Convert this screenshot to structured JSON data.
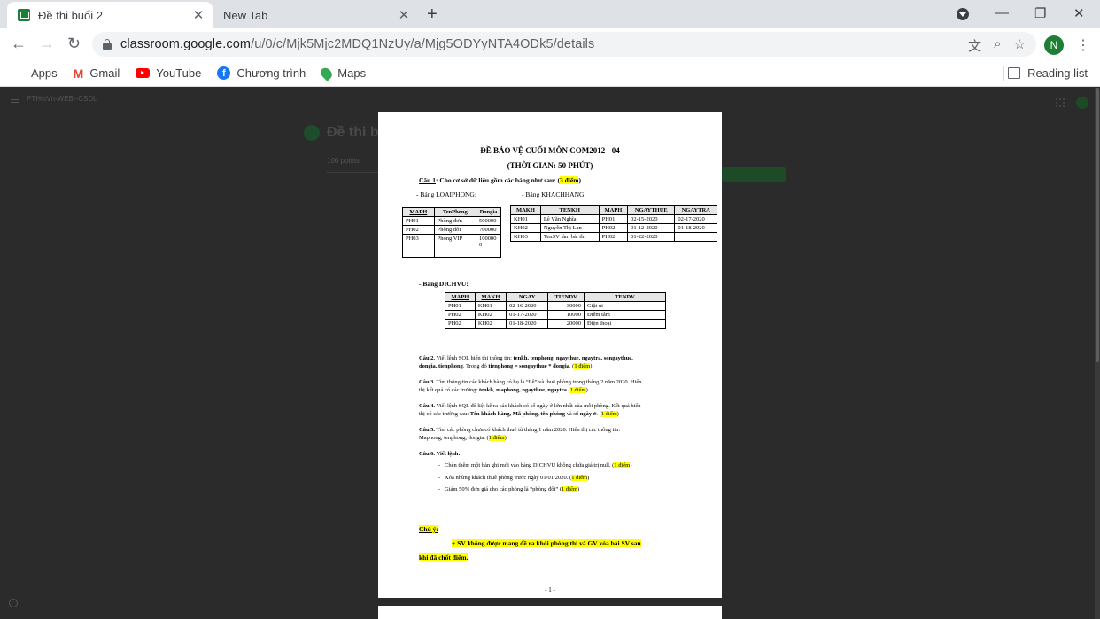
{
  "browser": {
    "tabs": [
      {
        "title": "Đề thi buổi 2",
        "close": "✕"
      },
      {
        "title": "New Tab",
        "close": "✕"
      }
    ],
    "new_tab": "+",
    "window_controls": {
      "minimize": "—",
      "restore": "❐",
      "close": "✕"
    },
    "url_host": "classroom.google.com",
    "url_path": "/u/0/c/Mjk5Mjc2MDQ1NzUy/a/Mjg5ODYyNTA4ODk5/details",
    "avatar_letter": "N",
    "bookmarks": [
      {
        "label": "Apps"
      },
      {
        "label": "Gmail"
      },
      {
        "label": "YouTube"
      },
      {
        "label": "Chương trình"
      },
      {
        "label": "Maps"
      }
    ],
    "reading_list": "Reading list"
  },
  "document": {
    "title1": "ĐỀ BẢO VỆ CUỐI MÔN COM2012 - 04",
    "title2": "(THỜI GIAN: 50 PHÚT)",
    "q1_label": "Câu 1",
    "q1_text": ": Cho cơ sở dữ liệu gồm các bảng như sau: (",
    "q1_points": "3 điểm",
    "q1_close": ")",
    "table_loaiphong_label": "- Bảng LOAIPHONG:",
    "table_khachhang_label": "- Bảng KHACHHANG:",
    "loaiphong": {
      "headers": [
        "MAPH",
        "TenPhong",
        "Dongia"
      ],
      "rows": [
        [
          "PH01",
          "Phòng đơn",
          "500000"
        ],
        [
          "PH02",
          "Phòng đôi",
          "700000"
        ],
        [
          "PH03",
          "Phòng VIP",
          "1000000"
        ]
      ]
    },
    "khachhang": {
      "headers": [
        "MAKH",
        "TENKH",
        "MAPH",
        "NGAYTHUE",
        "NGAYTRA"
      ],
      "rows": [
        [
          "KH01",
          "Lê Văn Nghĩa",
          "PH01",
          "02-15-2020",
          "02-17-2020"
        ],
        [
          "KH02",
          "Nguyễn Thị Lan",
          "PH02",
          "01-12-2020",
          "01-18-2020"
        ],
        [
          "KH03",
          "TenSV làm bài thi",
          "PH02",
          "01-22-2020",
          ""
        ]
      ]
    },
    "table_dichvu_label": "- Bảng DICHVU:",
    "dichvu": {
      "headers": [
        "MAPH",
        "MAKH",
        "NGAY",
        "TIENDV",
        "TENDV"
      ],
      "rows": [
        [
          "PH01",
          "KH01",
          "02-16-2020",
          "30000",
          "Giặt ủi"
        ],
        [
          "PH02",
          "KH02",
          "01-17-2020",
          "10000",
          "Điểm tâm"
        ],
        [
          "PH02",
          "KH02",
          "01-18-2020",
          "20000",
          "Điện thoại"
        ]
      ]
    },
    "q2_a": "Câu 2.",
    "q2_b": " Viết lệnh SQL hiển thị thông tin: ",
    "q2_c": "tenkh, tenphong, ngaythue, ngaytra, songaythue,",
    "q2_d": "dongia, tienphong",
    "q2_e": ". Trong đó ",
    "q2_f": "tienphong = songaythue * dongia",
    "q2_pts": "1 điểm",
    "q3_a": "Câu 3.",
    "q3_b": " Tìm thông tin các khách hàng có họ là “Lê” và thuê phòng trong tháng 2 năm 2020. Hiển",
    "q3_c": "thị kết quả có các trường: ",
    "q3_d": "tenkh, maphong, ngaythue, ngaytra",
    "q3_pts": "1 điểm",
    "q4_a": "Câu 4.",
    "q4_b": " Viết lệnh SQL để liệt kê ra các khách có số ngày ở lớn nhất của mỗi phòng. Kết quả hiển",
    "q4_c": "thị có các trường sau: ",
    "q4_d": "Tên khách hàng, Mã phòng, tên phòng",
    "q4_e": " và ",
    "q4_f": "số ngày ở",
    "q4_pts": "1 điểm",
    "q5_a": "Câu 5.",
    "q5_b": " Tìm các phòng chưa có khách thuê từ tháng 1 năm 2020. Hiển thị các thông tin:",
    "q5_c": "Maphong, tenphong, dongia. (",
    "q5_pts": "1 điểm",
    "q6_a": "Câu 6. Viết lệnh:",
    "q6_items": [
      {
        "text": "Chèn thêm một bản ghi mới vào bảng DICHVU không chứa giá trị null. (",
        "pts": "1 điểm"
      },
      {
        "text": "Xóa những khách thuê phòng trước ngày 01/01/2020. (",
        "pts": "1 điểm"
      },
      {
        "text": "Giảm 50% đơn giá cho các phòng là “phòng đôi” (",
        "pts": "1 điểm"
      }
    ],
    "note_label": "Chú ý:",
    "note_line1": "+ SV không được mang đề ra khỏi phòng thi và GV xóa bài SV sau",
    "note_line2": "khi đã chốt điểm.",
    "page_number": "- 1 -"
  },
  "background": {
    "course": "PTHctVn-WEB--CSDL",
    "assignment_title": "Đề thi bu",
    "points": "100 points"
  }
}
